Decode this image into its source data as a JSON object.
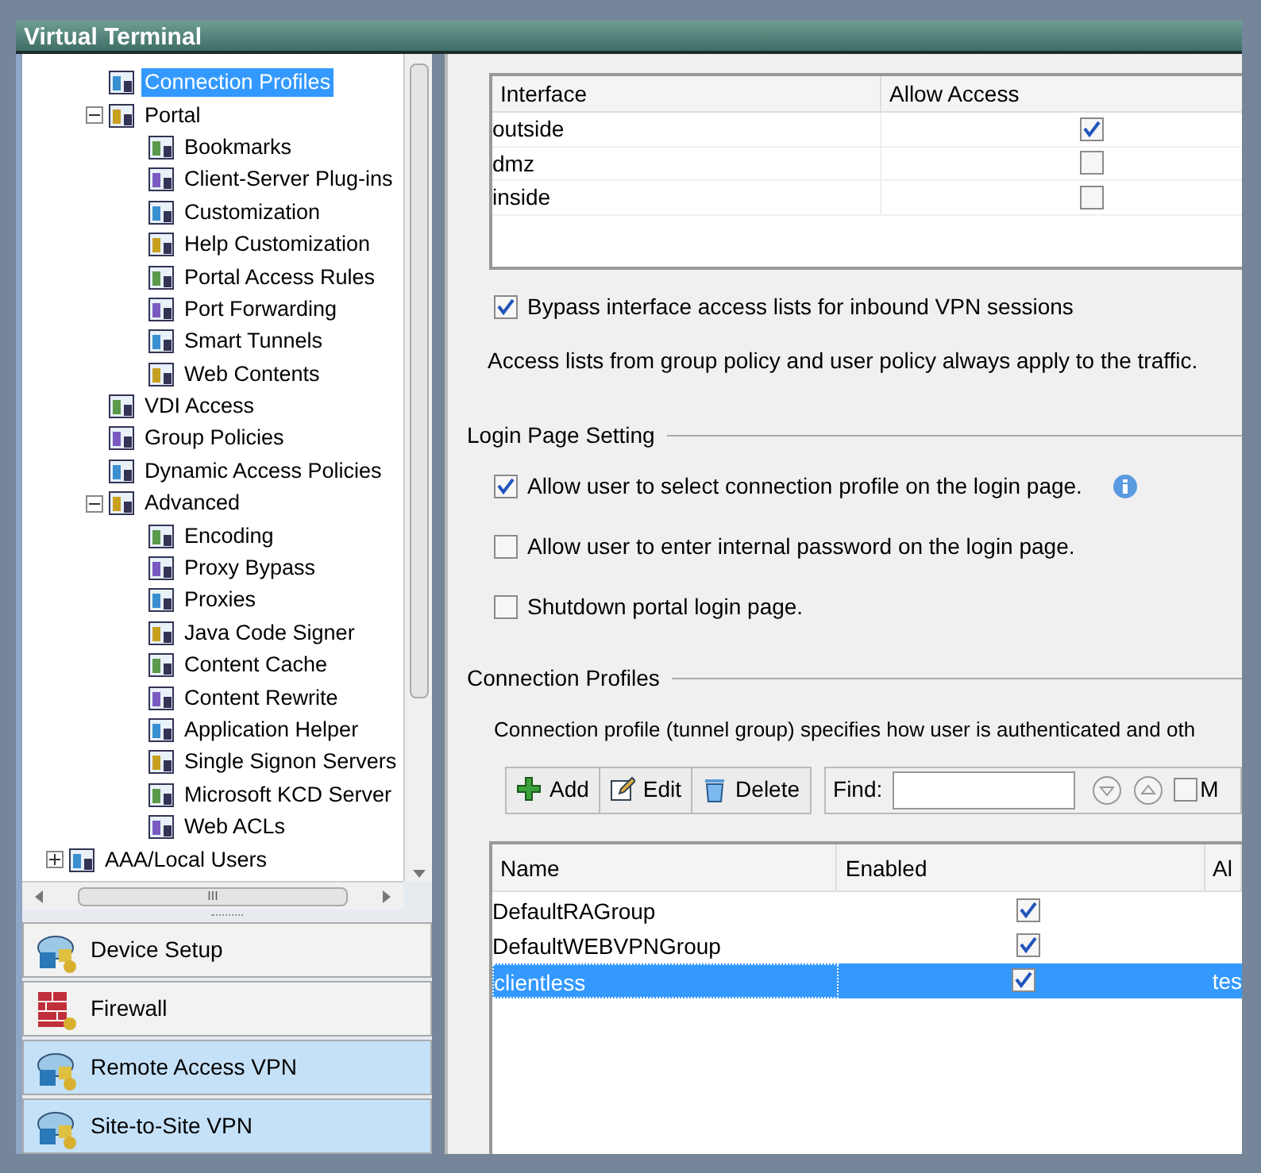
{
  "window": {
    "title": "Virtual Terminal"
  },
  "tree": {
    "items": [
      {
        "label": "Connection Profiles",
        "selected": true
      },
      {
        "label": "Portal",
        "selected": false,
        "expanded": true,
        "children": [
          {
            "label": "Bookmarks",
            "selected": false
          },
          {
            "label": "Client-Server Plug-ins",
            "selected": false
          },
          {
            "label": "Customization",
            "selected": false
          },
          {
            "label": "Help Customization",
            "selected": false
          },
          {
            "label": "Portal Access Rules",
            "selected": false
          },
          {
            "label": "Port Forwarding",
            "selected": false
          },
          {
            "label": "Smart Tunnels",
            "selected": false
          },
          {
            "label": "Web Contents",
            "selected": false
          }
        ]
      },
      {
        "label": "VDI Access",
        "selected": false
      },
      {
        "label": "Group Policies",
        "selected": false
      },
      {
        "label": "Dynamic Access Policies",
        "selected": false
      },
      {
        "label": "Advanced",
        "selected": false,
        "expanded": true,
        "children": [
          {
            "label": "Encoding",
            "selected": false
          },
          {
            "label": "Proxy Bypass",
            "selected": false
          },
          {
            "label": "Proxies",
            "selected": false
          },
          {
            "label": "Java Code Signer",
            "selected": false
          },
          {
            "label": "Content Cache",
            "selected": false
          },
          {
            "label": "Content Rewrite",
            "selected": false
          },
          {
            "label": "Application Helper",
            "selected": false
          },
          {
            "label": "Single Signon Servers",
            "selected": false
          },
          {
            "label": "Microsoft KCD Server",
            "selected": false
          },
          {
            "label": "Web ACLs",
            "selected": false
          }
        ]
      }
    ],
    "root_items": [
      {
        "label": "AAA/Local Users",
        "selected": false,
        "expanded": false
      }
    ],
    "scroll_mark": "III"
  },
  "nav": [
    {
      "label": "Device Setup",
      "selected": false
    },
    {
      "label": "Firewall",
      "selected": false
    },
    {
      "label": "Remote Access VPN",
      "selected": true
    },
    {
      "label": "Site-to-Site VPN",
      "selected": true
    }
  ],
  "interfaces": {
    "columns": [
      "Interface",
      "Allow Access"
    ],
    "rows": [
      {
        "name": "outside",
        "checked": true
      },
      {
        "name": "dmz",
        "checked": false
      },
      {
        "name": "inside",
        "checked": false
      }
    ]
  },
  "bypass": {
    "label": "Bypass interface access lists for inbound VPN sessions",
    "checked": true
  },
  "note": "Access lists from group policy and user policy always apply to the traffic.",
  "login_page": {
    "title": "Login Page Setting",
    "options": [
      {
        "label": "Allow user to select connection profile on the login page.",
        "checked": true,
        "info": true
      },
      {
        "label": "Allow user to enter internal password on the login page.",
        "checked": false,
        "info": false
      },
      {
        "label": "Shutdown portal login page.",
        "checked": false,
        "info": false
      }
    ]
  },
  "profiles": {
    "title": "Connection Profiles",
    "description": "Connection profile (tunnel group) specifies how user is authenticated and oth",
    "toolbar": [
      {
        "kind": "add",
        "label": "Add"
      },
      {
        "kind": "edit",
        "label": "Edit"
      },
      {
        "kind": "delete",
        "label": "Delete"
      }
    ],
    "find": {
      "label": "Find:",
      "match_checked": false,
      "match_label": "M"
    },
    "columns": [
      "Name",
      "Enabled",
      "Al"
    ],
    "rows": [
      {
        "name": "DefaultRAGroup",
        "enabled": true,
        "column_3": "",
        "selected": false
      },
      {
        "name": "DefaultWEBVPNGroup",
        "enabled": true,
        "column_3": "",
        "selected": false
      },
      {
        "name": "clientless",
        "enabled": true,
        "column_3": "tes",
        "selected": true
      }
    ]
  }
}
